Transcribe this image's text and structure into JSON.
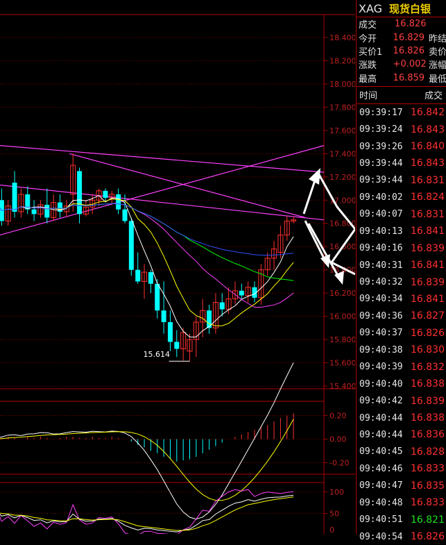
{
  "symbol": "XAG",
  "name": "现货白银",
  "quotes": [
    {
      "label": "成交",
      "value": "16.826",
      "extra": ""
    },
    {
      "label": "今开",
      "value": "16.829",
      "extra": "昨结"
    },
    {
      "label": "买价1",
      "value": "16.826",
      "extra": "卖价"
    },
    {
      "label": "涨跌",
      "value": "+0.002",
      "extra": "涨幅"
    },
    {
      "label": "最高",
      "value": "16.859",
      "extra": "最低"
    }
  ],
  "ticks_header": {
    "time": "时间",
    "price": "成交"
  },
  "ticks": [
    {
      "time": "09:39:17",
      "price": "16.842",
      "dir": "up"
    },
    {
      "time": "09:39:24",
      "price": "16.843",
      "dir": "up"
    },
    {
      "time": "09:39:26",
      "price": "16.840",
      "dir": "up"
    },
    {
      "time": "09:39:44",
      "price": "16.843",
      "dir": "up"
    },
    {
      "time": "09:39:44",
      "price": "16.831",
      "dir": "up"
    },
    {
      "time": "09:40:02",
      "price": "16.824",
      "dir": "up"
    },
    {
      "time": "09:40:07",
      "price": "16.831",
      "dir": "up"
    },
    {
      "time": "09:40:13",
      "price": "16.841",
      "dir": "up"
    },
    {
      "time": "09:40:16",
      "price": "16.839",
      "dir": "up"
    },
    {
      "time": "09:40:31",
      "price": "16.841",
      "dir": "up"
    },
    {
      "time": "09:40:32",
      "price": "16.839",
      "dir": "up"
    },
    {
      "time": "09:40:34",
      "price": "16.841",
      "dir": "up"
    },
    {
      "time": "09:40:36",
      "price": "16.827",
      "dir": "up"
    },
    {
      "time": "09:40:37",
      "price": "16.826",
      "dir": "up"
    },
    {
      "time": "09:40:38",
      "price": "16.830",
      "dir": "up"
    },
    {
      "time": "09:40:39",
      "price": "16.832",
      "dir": "up"
    },
    {
      "time": "09:40:40",
      "price": "16.838",
      "dir": "up"
    },
    {
      "time": "09:40:42",
      "price": "16.839",
      "dir": "up"
    },
    {
      "time": "09:40:44",
      "price": "16.838",
      "dir": "up"
    },
    {
      "time": "09:40:44",
      "price": "16.836",
      "dir": "up"
    },
    {
      "time": "09:40:45",
      "price": "16.828",
      "dir": "up"
    },
    {
      "time": "09:40:46",
      "price": "16.833",
      "dir": "up"
    },
    {
      "time": "09:40:47",
      "price": "16.835",
      "dir": "up"
    },
    {
      "time": "09:40:48",
      "price": "16.833",
      "dir": "up"
    },
    {
      "time": "09:40:51",
      "price": "16.821",
      "dir": "dn"
    },
    {
      "time": "09:40:54",
      "price": "16.826",
      "dir": "up"
    }
  ],
  "colors": {
    "up": "#ff3030",
    "down": "#00ffff",
    "grid": "#b00000",
    "axis_text": "#c02020"
  },
  "chart_data": {
    "type": "candlestick",
    "price_axis": {
      "ylim": [
        15.4,
        18.5
      ],
      "ticks": [
        "18.400",
        "18.200",
        "18.000",
        "17.800",
        "17.600",
        "17.400",
        "17.200",
        "17.000",
        "16.800",
        "16.600",
        "16.400",
        "16.200",
        "16.000",
        "15.800",
        "15.600",
        "15.400"
      ]
    },
    "annotations": [
      {
        "text": "15.614",
        "price": 15.614
      }
    ],
    "candles": [
      {
        "o": 16.85,
        "h": 17.05,
        "l": 16.8,
        "c": 17.0
      },
      {
        "o": 17.0,
        "h": 17.1,
        "l": 16.78,
        "c": 16.82
      },
      {
        "o": 16.82,
        "h": 17.0,
        "l": 16.78,
        "c": 16.95
      },
      {
        "o": 17.15,
        "h": 17.25,
        "l": 16.85,
        "c": 16.9
      },
      {
        "o": 16.9,
        "h": 17.1,
        "l": 16.85,
        "c": 17.05
      },
      {
        "o": 17.05,
        "h": 17.12,
        "l": 16.88,
        "c": 16.92
      },
      {
        "o": 16.92,
        "h": 17.0,
        "l": 16.82,
        "c": 16.88
      },
      {
        "o": 16.88,
        "h": 17.0,
        "l": 16.85,
        "c": 16.96
      },
      {
        "o": 16.96,
        "h": 17.1,
        "l": 16.8,
        "c": 16.85
      },
      {
        "o": 16.85,
        "h": 17.05,
        "l": 16.82,
        "c": 16.98
      },
      {
        "o": 16.98,
        "h": 17.05,
        "l": 16.85,
        "c": 16.9
      },
      {
        "o": 16.9,
        "h": 17.0,
        "l": 16.86,
        "c": 16.95
      },
      {
        "o": 17.05,
        "h": 17.4,
        "l": 16.9,
        "c": 17.3
      },
      {
        "o": 17.25,
        "h": 17.28,
        "l": 16.8,
        "c": 16.88
      },
      {
        "o": 16.88,
        "h": 17.0,
        "l": 16.86,
        "c": 16.94
      },
      {
        "o": 16.94,
        "h": 17.05,
        "l": 16.88,
        "c": 17.0
      },
      {
        "o": 17.0,
        "h": 17.1,
        "l": 16.95,
        "c": 17.08
      },
      {
        "o": 17.08,
        "h": 17.1,
        "l": 16.98,
        "c": 17.02
      },
      {
        "o": 17.02,
        "h": 17.08,
        "l": 16.96,
        "c": 17.05
      },
      {
        "o": 17.05,
        "h": 17.1,
        "l": 16.88,
        "c": 16.92
      },
      {
        "o": 16.92,
        "h": 17.05,
        "l": 16.8,
        "c": 16.82
      },
      {
        "o": 16.82,
        "h": 16.85,
        "l": 16.35,
        "c": 16.4
      },
      {
        "o": 16.4,
        "h": 16.55,
        "l": 16.28,
        "c": 16.3
      },
      {
        "o": 16.3,
        "h": 16.45,
        "l": 16.15,
        "c": 16.38
      },
      {
        "o": 16.38,
        "h": 16.4,
        "l": 16.2,
        "c": 16.28
      },
      {
        "o": 16.28,
        "h": 16.32,
        "l": 15.98,
        "c": 16.05
      },
      {
        "o": 16.05,
        "h": 16.3,
        "l": 15.85,
        "c": 15.95
      },
      {
        "o": 15.95,
        "h": 16.05,
        "l": 15.7,
        "c": 15.78
      },
      {
        "o": 15.78,
        "h": 15.88,
        "l": 15.65,
        "c": 15.72
      },
      {
        "o": 15.72,
        "h": 15.9,
        "l": 15.62,
        "c": 15.86
      },
      {
        "o": 15.7,
        "h": 15.85,
        "l": 15.614,
        "c": 15.8
      },
      {
        "o": 15.8,
        "h": 16.0,
        "l": 15.65,
        "c": 15.95
      },
      {
        "o": 15.95,
        "h": 16.15,
        "l": 15.82,
        "c": 16.05
      },
      {
        "o": 16.05,
        "h": 16.1,
        "l": 15.85,
        "c": 15.9
      },
      {
        "o": 15.9,
        "h": 16.2,
        "l": 15.85,
        "c": 16.12
      },
      {
        "o": 16.12,
        "h": 16.2,
        "l": 16.0,
        "c": 16.06
      },
      {
        "o": 16.06,
        "h": 16.25,
        "l": 16.02,
        "c": 16.15
      },
      {
        "o": 16.15,
        "h": 16.3,
        "l": 16.1,
        "c": 16.22
      },
      {
        "o": 16.22,
        "h": 16.28,
        "l": 16.15,
        "c": 16.18
      },
      {
        "o": 16.18,
        "h": 16.3,
        "l": 16.12,
        "c": 16.25
      },
      {
        "o": 16.25,
        "h": 16.3,
        "l": 16.12,
        "c": 16.16
      },
      {
        "o": 16.16,
        "h": 16.45,
        "l": 16.1,
        "c": 16.4
      },
      {
        "o": 16.4,
        "h": 16.55,
        "l": 16.35,
        "c": 16.5
      },
      {
        "o": 16.5,
        "h": 16.65,
        "l": 16.4,
        "c": 16.58
      },
      {
        "o": 16.55,
        "h": 16.78,
        "l": 16.5,
        "c": 16.7
      },
      {
        "o": 16.7,
        "h": 16.86,
        "l": 16.65,
        "c": 16.82
      },
      {
        "o": 16.82,
        "h": 16.86,
        "l": 16.8,
        "c": 16.83
      }
    ],
    "macd_axis": {
      "ylim": [
        -0.28,
        0.28
      ],
      "ticks": [
        "0.20",
        "0.00",
        "-0.20"
      ]
    },
    "macd_hist": [
      0.01,
      0.01,
      0.02,
      0.01,
      0.0,
      0.02,
      0.01,
      0.02,
      0.01,
      0.0,
      0.01,
      0.02,
      0.02,
      0.01,
      0.01,
      0.02,
      0.01,
      0.01,
      0.02,
      0.01,
      0.0,
      -0.02,
      -0.05,
      -0.07,
      -0.1,
      -0.12,
      -0.15,
      -0.17,
      -0.19,
      -0.18,
      -0.17,
      -0.15,
      -0.12,
      -0.09,
      -0.06,
      -0.03,
      0.0,
      0.02,
      0.04,
      0.06,
      0.08,
      0.1,
      0.12,
      0.15,
      0.18,
      0.2,
      0.22
    ],
    "kdj_axis": {
      "ylim": [
        0,
        110
      ],
      "ticks": [
        "100",
        "50",
        "0"
      ]
    }
  }
}
